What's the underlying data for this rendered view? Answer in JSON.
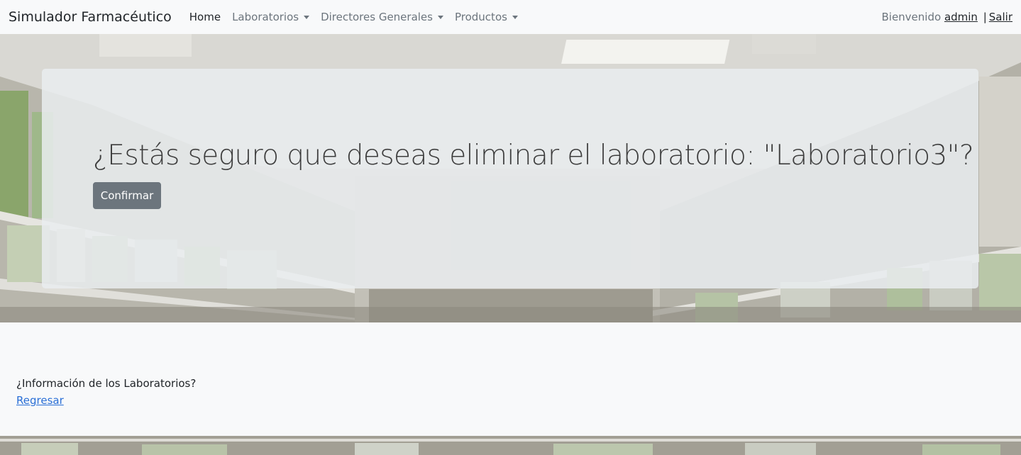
{
  "navbar": {
    "brand": "Simulador Farmacéutico",
    "links": [
      {
        "label": "Home"
      },
      {
        "label": "Laboratorios"
      },
      {
        "label": "Directores Generales"
      },
      {
        "label": "Productos"
      }
    ],
    "welcome": "Bienvenido",
    "username": "admin",
    "separator": "|",
    "logout": "Salir"
  },
  "hero": {
    "title": "¿Estás seguro que deseas eliminar el laboratorio: \"Laboratorio3\"?",
    "confirm_label": "Confirmar"
  },
  "content": {
    "question": "¿Información de los Laboratorios?",
    "back_link": "Regresar"
  },
  "colors": {
    "navbar_bg": "#f8f9fa",
    "button_secondary": "#6c757d",
    "link": "#2a6fd6"
  }
}
